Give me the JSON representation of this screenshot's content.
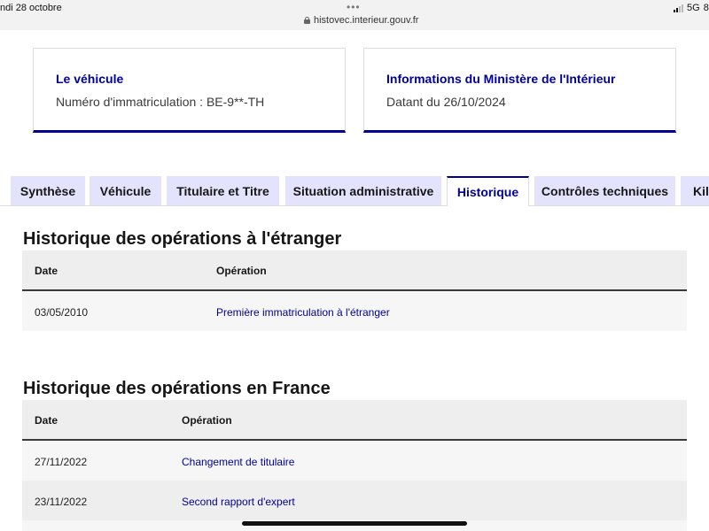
{
  "status_bar": {
    "date": "ndi 28 octobre",
    "url": "histovec.interieur.gouv.fr",
    "network": "5G",
    "battery_partial": "8",
    "more_icon": "more-dots-icon",
    "lock_icon": "lock-icon",
    "signal_icon": "signal-icon"
  },
  "cards": {
    "vehicle": {
      "title": "Le véhicule",
      "text": "Numéro d'immatriculation : BE-9**-TH"
    },
    "ministry": {
      "title": "Informations du Ministère de l'Intérieur",
      "text": "Datant du 26/10/2024"
    }
  },
  "tabs": [
    {
      "label": "Synthèse",
      "active": false
    },
    {
      "label": "Véhicule",
      "active": false
    },
    {
      "label": "Titulaire et Titre",
      "active": false
    },
    {
      "label": "Situation administrative",
      "active": false
    },
    {
      "label": "Historique",
      "active": true
    },
    {
      "label": "Contrôles techniques",
      "active": false
    },
    {
      "label": "Kilo",
      "active": false
    }
  ],
  "foreign_history": {
    "title": "Historique des opérations à l'étranger",
    "headers": {
      "date": "Date",
      "operation": "Opération"
    },
    "rows": [
      {
        "date": "03/05/2010",
        "operation": "Première immatriculation à l'étranger"
      }
    ]
  },
  "france_history": {
    "title": "Historique des opérations en France",
    "headers": {
      "date": "Date",
      "operation": "Opération"
    },
    "rows": [
      {
        "date": "27/11/2022",
        "operation": "Changement de titulaire"
      },
      {
        "date": "23/11/2022",
        "operation": "Second rapport d'expert"
      }
    ]
  },
  "colors": {
    "primary_blue": "#000091",
    "tab_background": "#e3e3fd",
    "table_header_bg": "#eeeeee"
  }
}
